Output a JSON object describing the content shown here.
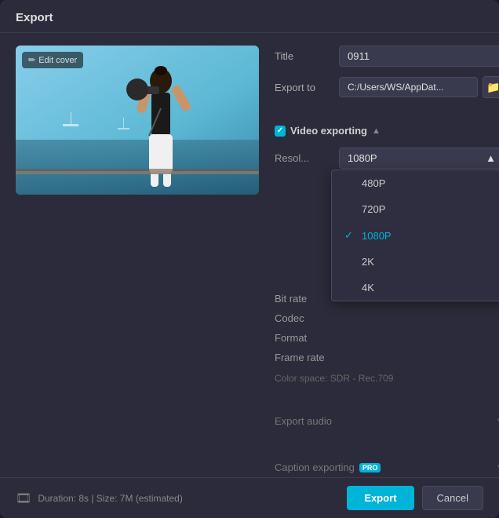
{
  "dialog": {
    "title": "Export",
    "header": {
      "title_label": "Export"
    },
    "cover": {
      "edit_label": "Edit cover"
    },
    "form": {
      "title_label": "Title",
      "title_value": "0911",
      "export_to_label": "Export to",
      "export_path": "C:/Users/WS/AppDat...",
      "folder_icon": "📁"
    },
    "video_section": {
      "checkbox_check": "✓",
      "label": "Video exporting",
      "arrow": "▲",
      "resolution_label": "Resol...",
      "resolution_value": "1080P",
      "bitrate_label": "Bit rate",
      "codec_label": "Codec",
      "format_label": "Format",
      "framerate_label": "Frame rate",
      "color_space": "Color space: SDR - Rec.709",
      "dropdown_arrow": "▲",
      "options": [
        {
          "value": "480P",
          "selected": false
        },
        {
          "value": "720P",
          "selected": false
        },
        {
          "value": "1080P",
          "selected": true
        },
        {
          "value": "2K",
          "selected": false
        },
        {
          "value": "4K",
          "selected": false
        }
      ]
    },
    "audio_section": {
      "label": "Export audio",
      "arrow": "▼",
      "collapsed_arrow": "▼"
    },
    "caption_section": {
      "label": "Caption exporting",
      "badge": "PRO",
      "arrow": "▼"
    },
    "footer": {
      "film_icon": "🎞",
      "info": "Duration: 8s | Size: 7M (estimated)",
      "export_btn": "Export",
      "cancel_btn": "Cancel"
    }
  }
}
